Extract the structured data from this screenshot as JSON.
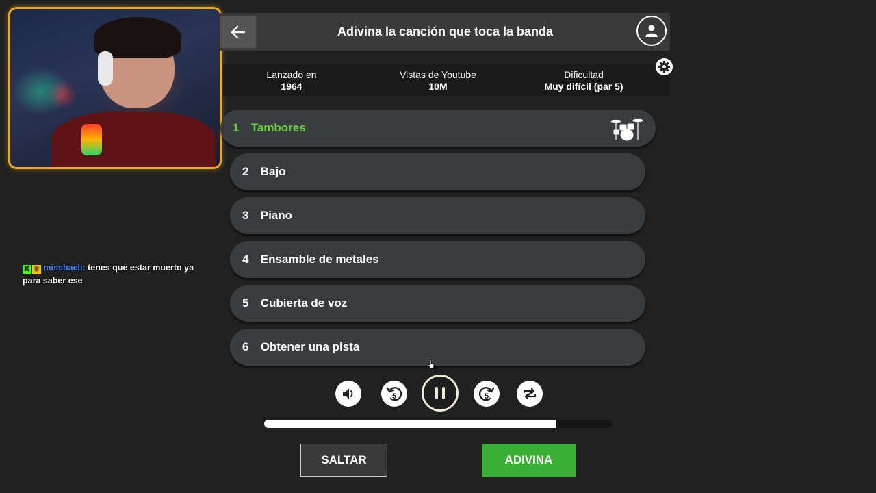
{
  "webcam": {
    "icon": "webcam-streamer"
  },
  "chat": {
    "badges": [
      "K",
      "♛"
    ],
    "username": "missbaeli:",
    "message": "tenes que estar muerto ya para saber ese"
  },
  "header": {
    "title": "Adivina la canción que toca la banda",
    "back_icon": "arrow-left-icon",
    "profile_icon": "user-icon"
  },
  "info": [
    {
      "label": "Lanzado en",
      "value": "1964"
    },
    {
      "label": "Vistas de Youtube",
      "value": "10M"
    },
    {
      "label": "Dificultad",
      "value": "Muy difícil (par 5)"
    }
  ],
  "settings_icon": "gear-icon",
  "tracks": [
    {
      "num": "1",
      "label": "Tambores",
      "active": true,
      "icon": "drum-kit-icon"
    },
    {
      "num": "2",
      "label": "Bajo",
      "active": false
    },
    {
      "num": "3",
      "label": "Piano",
      "active": false
    },
    {
      "num": "4",
      "label": "Ensamble de metales",
      "active": false
    },
    {
      "num": "5",
      "label": "Cubierta de voz",
      "active": false
    },
    {
      "num": "6",
      "label": "Obtener una pista",
      "active": false
    }
  ],
  "controls": {
    "volume_icon": "volume-icon",
    "rewind_label": "5",
    "forward_label": "5",
    "play_state": "pause",
    "repeat_icon": "repeat-icon",
    "progress": 0.84
  },
  "buttons": {
    "skip": "SALTAR",
    "guess": "ADIVINA"
  },
  "colors": {
    "accent_green": "#3cb034",
    "active_track": "#6bcf3a",
    "cam_border": "#f2a81d"
  }
}
